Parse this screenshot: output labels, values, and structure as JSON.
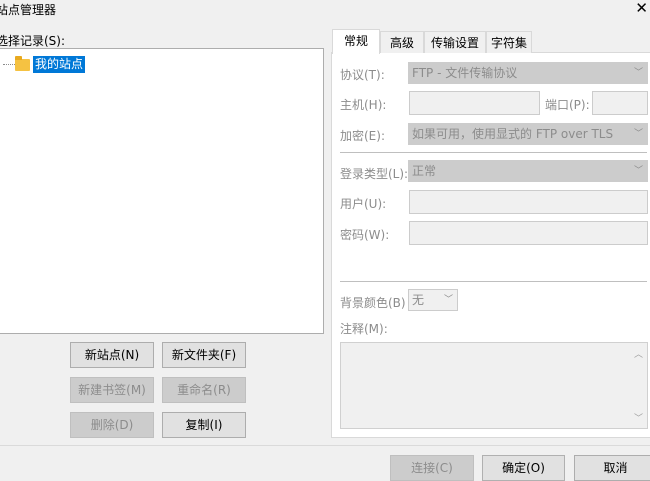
{
  "window": {
    "title": "站点管理器"
  },
  "tree": {
    "label": "选择记录(S):",
    "nodes": [
      {
        "label": "我的站点"
      }
    ]
  },
  "tree_buttons": {
    "new_site": "新站点(N)",
    "new_folder": "新文件夹(F)",
    "new_bookmark": "新建书签(M)",
    "rename": "重命名(R)",
    "delete": "删除(D)",
    "copy": "复制(I)"
  },
  "tabs": [
    {
      "label": "常规"
    },
    {
      "label": "高级"
    },
    {
      "label": "传输设置"
    },
    {
      "label": "字符集"
    }
  ],
  "general": {
    "protocol": {
      "label": "协议(T):",
      "value": "FTP - 文件传输协议"
    },
    "host": {
      "label": "主机(H):",
      "value": ""
    },
    "port": {
      "label": "端口(P):",
      "value": ""
    },
    "encryption": {
      "label": "加密(E):",
      "value": "如果可用，使用显式的 FTP over TLS"
    },
    "logon_type": {
      "label": "登录类型(L):",
      "value": "正常"
    },
    "user": {
      "label": "用户(U):",
      "value": ""
    },
    "password": {
      "label": "密码(W):",
      "value": ""
    },
    "background_color": {
      "label": "背景颜色(B)",
      "value": "无"
    },
    "comments": {
      "label": "注释(M):",
      "value": ""
    }
  },
  "dialog_buttons": {
    "connect": "连接(C)",
    "ok": "确定(O)",
    "cancel": "取消"
  }
}
